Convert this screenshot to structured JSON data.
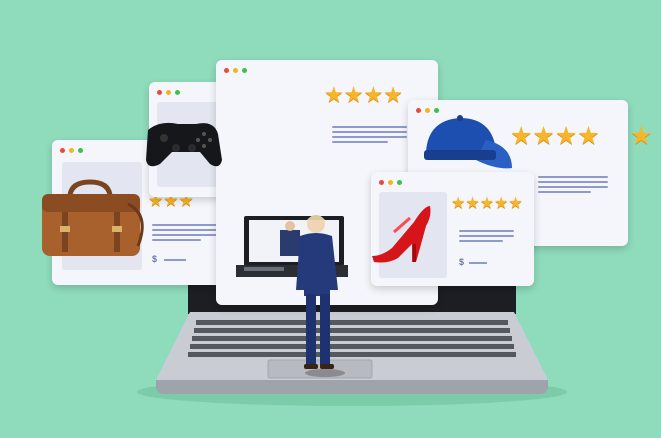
{
  "price_symbol": "$",
  "colors": {
    "background": "#8fdcbc",
    "card": "#f4f6fc",
    "star": "#f6b52a",
    "text_lines": "#8f9acb"
  },
  "products": [
    {
      "name": "leather-briefcase",
      "rating": 5
    },
    {
      "name": "game-controller",
      "rating": 5
    },
    {
      "name": "baseball-cap",
      "rating": 5
    },
    {
      "name": "red-high-heel",
      "rating": 5
    }
  ],
  "icons": [
    "star-icon",
    "briefcase-icon",
    "gamepad-icon",
    "cap-icon",
    "high-heel-icon",
    "laptop-icon",
    "businessman-figure"
  ]
}
